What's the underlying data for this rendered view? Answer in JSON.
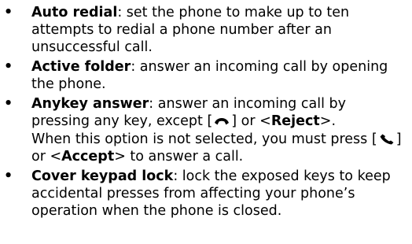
{
  "bullet_symbol": "•",
  "items": [
    {
      "term": "Auto redial",
      "text": ": set the phone to make up to ten attempts to redial a phone number after an unsuccessful call."
    },
    {
      "term": "Active folder",
      "text": ": answer an incoming call by opening the phone."
    },
    {
      "term": "Anykey answer",
      "text_part1": ": answer an incoming call by pressing any key, except [",
      "text_part2": "] or <",
      "reject_label": "Reject",
      "text_part3": ">.",
      "note_part1": "When this option is not selected, you must press [",
      "note_part2": "] or <",
      "accept_label": "Accept",
      "note_part3": "> to answer a call."
    },
    {
      "term": "Cover keypad lock",
      "text": ": lock the exposed keys to keep accidental presses from affecting your phone’s operation when the phone is closed."
    }
  ],
  "icons": {
    "end_key": "end-call-key-icon",
    "send_key": "send-call-key-icon"
  }
}
